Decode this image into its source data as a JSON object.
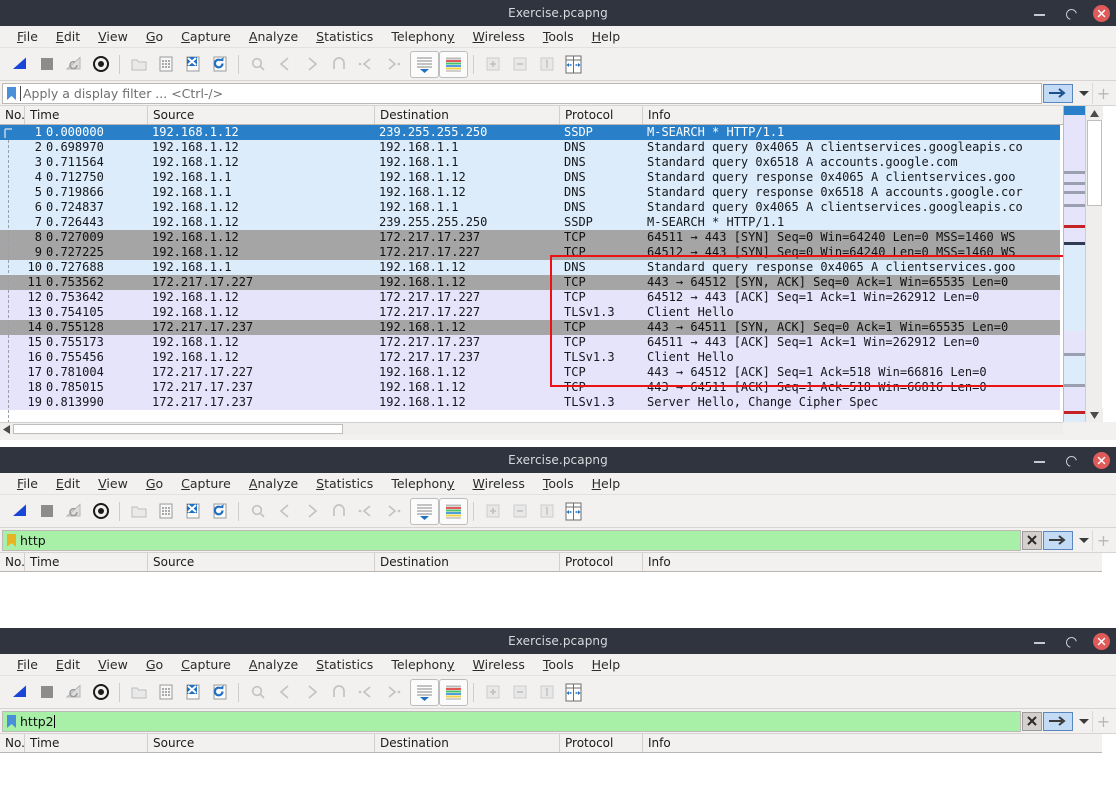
{
  "app": {
    "name": "Wireshark",
    "title": "Exercise.pcapng"
  },
  "window_controls": {
    "minimize": "minimize-icon",
    "maximize": "maximize-icon",
    "close": "close-icon"
  },
  "menu": [
    {
      "label": "File",
      "mnemonic": "F"
    },
    {
      "label": "Edit",
      "mnemonic": "E"
    },
    {
      "label": "View",
      "mnemonic": "V"
    },
    {
      "label": "Go",
      "mnemonic": "G"
    },
    {
      "label": "Capture",
      "mnemonic": "C"
    },
    {
      "label": "Analyze",
      "mnemonic": "A"
    },
    {
      "label": "Statistics",
      "mnemonic": "S"
    },
    {
      "label": "Telephony",
      "mnemonic": "y"
    },
    {
      "label": "Wireless",
      "mnemonic": "W"
    },
    {
      "label": "Tools",
      "mnemonic": "T"
    },
    {
      "label": "Help",
      "mnemonic": "H"
    }
  ],
  "toolbar": [
    {
      "name": "start-capture-icon",
      "enabled": true
    },
    {
      "name": "stop-capture-icon",
      "enabled": true
    },
    {
      "name": "restart-capture-icon",
      "enabled": false
    },
    {
      "name": "capture-options-icon",
      "enabled": true
    },
    {
      "name": "open-file-icon",
      "enabled": false
    },
    {
      "name": "save-file-icon",
      "enabled": true
    },
    {
      "name": "close-file-icon",
      "enabled": true
    },
    {
      "name": "reload-file-icon",
      "enabled": true
    },
    {
      "name": "find-packet-icon",
      "enabled": false
    },
    {
      "name": "go-back-icon",
      "enabled": false
    },
    {
      "name": "go-forward-icon",
      "enabled": false
    },
    {
      "name": "go-to-packet-icon",
      "enabled": false
    },
    {
      "name": "go-first-packet-icon",
      "enabled": false
    },
    {
      "name": "go-last-packet-icon",
      "enabled": false
    },
    {
      "name": "auto-scroll-icon",
      "enabled": true
    },
    {
      "name": "colorize-packets-icon",
      "enabled": true
    },
    {
      "name": "zoom-in-icon",
      "enabled": false
    },
    {
      "name": "zoom-out-icon",
      "enabled": false
    },
    {
      "name": "normal-size-icon",
      "enabled": false
    },
    {
      "name": "resize-columns-icon",
      "enabled": true
    }
  ],
  "windows": [
    {
      "id": "window-1",
      "filter": {
        "value": "",
        "placeholder": "Apply a display filter ... <Ctrl-/>",
        "state": "empty",
        "has_clear": false
      },
      "columns": [
        "No.",
        "Time",
        "Source",
        "Destination",
        "Protocol",
        "Info"
      ],
      "rows": [
        {
          "no": "1",
          "time": "0.000000",
          "src": "192.168.1.12",
          "dst": "239.255.255.250",
          "proto": "SSDP",
          "info": "M-SEARCH * HTTP/1.1",
          "style": "sel"
        },
        {
          "no": "2",
          "time": "0.698970",
          "src": "192.168.1.12",
          "dst": "192.168.1.1",
          "proto": "DNS",
          "info": "Standard query 0x4065 A clientservices.googleapis.co",
          "style": "blue"
        },
        {
          "no": "3",
          "time": "0.711564",
          "src": "192.168.1.12",
          "dst": "192.168.1.1",
          "proto": "DNS",
          "info": "Standard query 0x6518 A accounts.google.com",
          "style": "blue"
        },
        {
          "no": "4",
          "time": "0.712750",
          "src": "192.168.1.1",
          "dst": "192.168.1.12",
          "proto": "DNS",
          "info": "Standard query response 0x4065 A clientservices.goo",
          "style": "blue"
        },
        {
          "no": "5",
          "time": "0.719866",
          "src": "192.168.1.1",
          "dst": "192.168.1.12",
          "proto": "DNS",
          "info": "Standard query response 0x6518 A accounts.google.cor",
          "style": "blue"
        },
        {
          "no": "6",
          "time": "0.724837",
          "src": "192.168.1.12",
          "dst": "192.168.1.1",
          "proto": "DNS",
          "info": "Standard query 0x4065 A clientservices.googleapis.co",
          "style": "blue"
        },
        {
          "no": "7",
          "time": "0.726443",
          "src": "192.168.1.12",
          "dst": "239.255.255.250",
          "proto": "SSDP",
          "info": "M-SEARCH * HTTP/1.1",
          "style": "blue"
        },
        {
          "no": "8",
          "time": "0.727009",
          "src": "192.168.1.12",
          "dst": "172.217.17.237",
          "proto": "TCP",
          "info": "64511 → 443 [SYN] Seq=0 Win=64240 Len=0 MSS=1460 WS",
          "style": "gray"
        },
        {
          "no": "9",
          "time": "0.727225",
          "src": "192.168.1.12",
          "dst": "172.217.17.227",
          "proto": "TCP",
          "info": "64512 → 443 [SYN] Seq=0 Win=64240 Len=0 MSS=1460 WS",
          "style": "gray"
        },
        {
          "no": "10",
          "time": "0.727688",
          "src": "192.168.1.1",
          "dst": "192.168.1.12",
          "proto": "DNS",
          "info": "Standard query response 0x4065 A clientservices.goo",
          "style": "blue"
        },
        {
          "no": "11",
          "time": "0.753562",
          "src": "172.217.17.227",
          "dst": "192.168.1.12",
          "proto": "TCP",
          "info": "443 → 64512 [SYN, ACK] Seq=0 Ack=1 Win=65535 Len=0",
          "style": "gray"
        },
        {
          "no": "12",
          "time": "0.753642",
          "src": "192.168.1.12",
          "dst": "172.217.17.227",
          "proto": "TCP",
          "info": "64512 → 443 [ACK] Seq=1 Ack=1 Win=262912 Len=0",
          "style": "lav"
        },
        {
          "no": "13",
          "time": "0.754105",
          "src": "192.168.1.12",
          "dst": "172.217.17.227",
          "proto": "TLSv1.3",
          "info": "Client Hello",
          "style": "lav"
        },
        {
          "no": "14",
          "time": "0.755128",
          "src": "172.217.17.237",
          "dst": "192.168.1.12",
          "proto": "TCP",
          "info": "443 → 64511 [SYN, ACK] Seq=0 Ack=1 Win=65535 Len=0",
          "style": "gray"
        },
        {
          "no": "15",
          "time": "0.755173",
          "src": "192.168.1.12",
          "dst": "172.217.17.237",
          "proto": "TCP",
          "info": "64511 → 443 [ACK] Seq=1 Ack=1 Win=262912 Len=0",
          "style": "lav"
        },
        {
          "no": "16",
          "time": "0.755456",
          "src": "192.168.1.12",
          "dst": "172.217.17.237",
          "proto": "TLSv1.3",
          "info": "Client Hello",
          "style": "lav"
        },
        {
          "no": "17",
          "time": "0.781004",
          "src": "172.217.17.227",
          "dst": "192.168.1.12",
          "proto": "TCP",
          "info": "443 → 64512 [ACK] Seq=1 Ack=518 Win=66816 Len=0",
          "style": "lav"
        },
        {
          "no": "18",
          "time": "0.785015",
          "src": "172.217.17.237",
          "dst": "192.168.1.12",
          "proto": "TCP",
          "info": "443 → 64511 [ACK] Seq=1 Ack=518 Win=66816 Len=0",
          "style": "lav"
        },
        {
          "no": "19",
          "time": "0.813990",
          "src": "172.217.17.237",
          "dst": "192.168.1.12",
          "proto": "TLSv1.3",
          "info": "Server Hello, Change Cipher Spec",
          "style": "lav"
        }
      ],
      "annotation": {
        "name": "red-highlight-box",
        "color": "#ee1111",
        "covers_rows": "12-19"
      }
    },
    {
      "id": "window-2",
      "filter": {
        "value": "http",
        "placeholder": "Apply a display filter ... <Ctrl-/>",
        "state": "valid",
        "has_clear": true
      },
      "columns": [
        "No.",
        "Time",
        "Source",
        "Destination",
        "Protocol",
        "Info"
      ],
      "rows": []
    },
    {
      "id": "window-3",
      "filter": {
        "value": "http2",
        "placeholder": "Apply a display filter ... <Ctrl-/>",
        "state": "valid",
        "has_clear": true,
        "focused": true
      },
      "columns": [
        "No.",
        "Time",
        "Source",
        "Destination",
        "Protocol",
        "Info"
      ],
      "rows": []
    }
  ],
  "colors": {
    "titlebar_bg": "#2f343f",
    "titlebar_text": "#d8dade",
    "chrome_bg": "#f2f1f0",
    "row_selected": "#2a7fc9",
    "row_udp_blue": "#dcecfa",
    "row_tcp_gray": "#a5a5a5",
    "row_tls_lavender": "#e6e4fb",
    "filter_valid_green": "#a8f0a8",
    "annotation_red": "#ee1111",
    "close_button": "#e05a5a"
  }
}
